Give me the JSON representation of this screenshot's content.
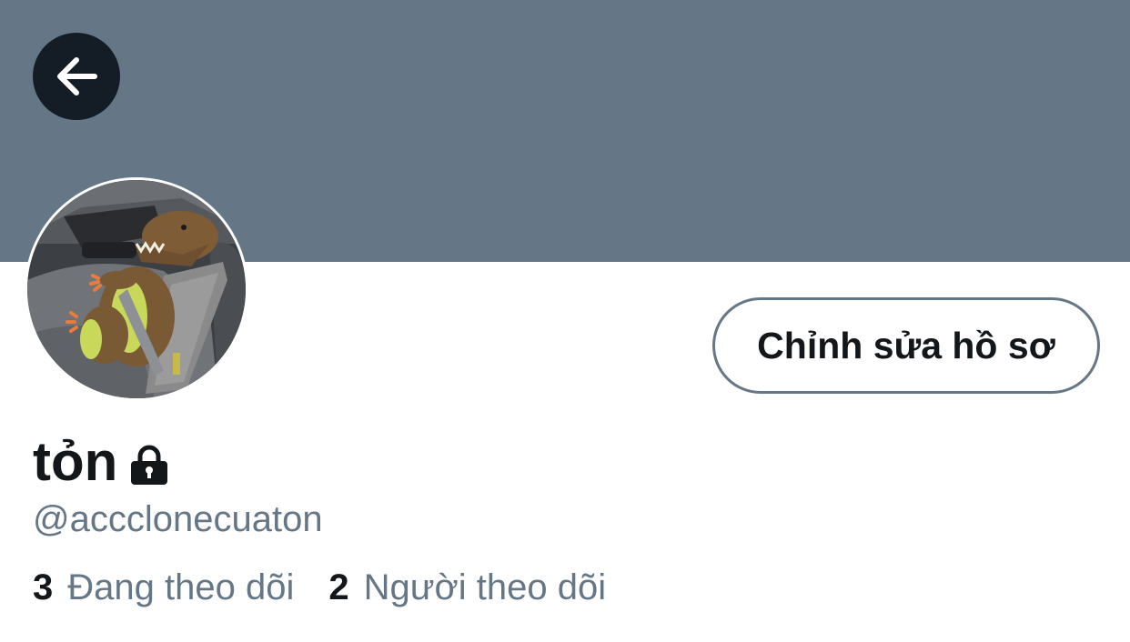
{
  "profile": {
    "display_name": "tỏn",
    "handle": "@accclonecuaton",
    "protected_icon": "lock-icon",
    "avatar_alt": "plush dinosaur in car seat"
  },
  "header": {
    "back_icon": "arrow-left-icon",
    "banner_color": "#657786"
  },
  "actions": {
    "edit_profile_label": "Chỉnh sửa hồ sơ"
  },
  "stats": {
    "following_count": "3",
    "following_label": "Đang theo dõi",
    "followers_count": "2",
    "followers_label": "Người theo dõi"
  },
  "colors": {
    "text_primary": "#14171a",
    "text_secondary": "#657786",
    "back_button_bg": "#141d26"
  }
}
